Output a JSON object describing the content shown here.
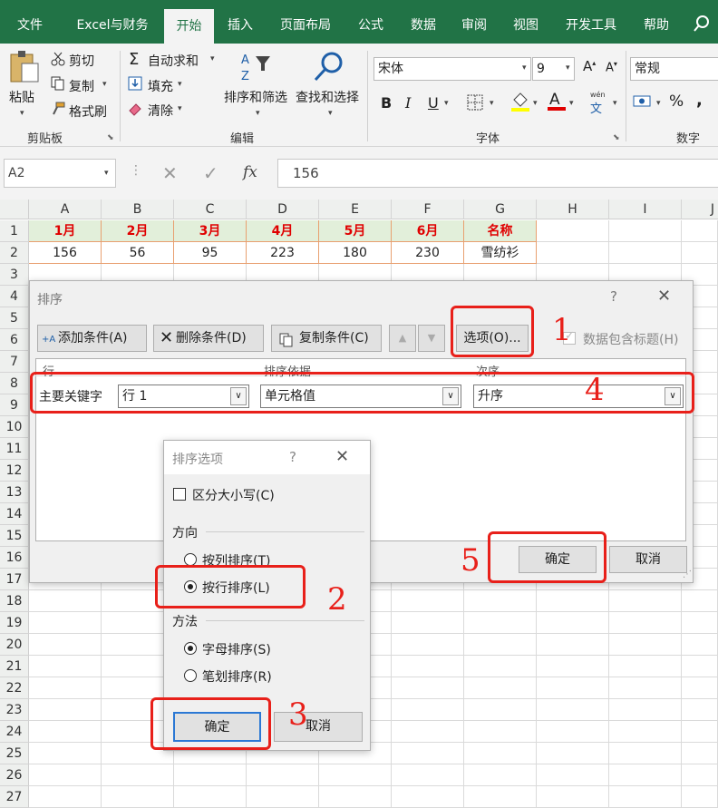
{
  "menu": {
    "tabs": [
      "文件",
      "Excel与财务",
      "开始",
      "插入",
      "页面布局",
      "公式",
      "数据",
      "审阅",
      "视图",
      "开发工具",
      "帮助"
    ],
    "active": "开始"
  },
  "ribbon": {
    "paste": "粘贴",
    "cut": "剪切",
    "copy": "复制",
    "format_painter": "格式刷",
    "clipboard_group": "剪贴板",
    "autosum": "自动求和",
    "fill": "填充",
    "clear": "清除",
    "sort_filter": "排序和筛选",
    "find_select": "查找和选择",
    "edit_group": "编辑",
    "font_name": "宋体",
    "font_size": "9",
    "font_group": "字体",
    "number_format": "常规",
    "number_group": "数字",
    "bold": "B",
    "italic": "I",
    "underline": "U",
    "wen": "wén",
    "wen_char": "文",
    "percent": "%",
    "comma": ","
  },
  "formula_bar": {
    "name_box": "A2",
    "fx": "fx",
    "value": "156"
  },
  "sheet": {
    "columns": [
      "A",
      "B",
      "C",
      "D",
      "E",
      "F",
      "G",
      "H",
      "I",
      "J"
    ],
    "rows": [
      "1",
      "2",
      "3",
      "4",
      "5",
      "6",
      "7",
      "8",
      "9",
      "10",
      "11",
      "12",
      "13",
      "14",
      "15",
      "16",
      "17",
      "18",
      "19",
      "20",
      "21",
      "22",
      "23",
      "24",
      "25",
      "26",
      "27"
    ],
    "row1": [
      "1月",
      "2月",
      "3月",
      "4月",
      "5月",
      "6月",
      "名称"
    ],
    "row2": [
      "156",
      "56",
      "95",
      "223",
      "180",
      "230",
      "雪纺衫"
    ]
  },
  "sort_dialog": {
    "title": "排序",
    "help": "?",
    "add": "添加条件(A)",
    "delete": "删除条件(D)",
    "copy": "复制条件(C)",
    "options": "选项(O)...",
    "header_checkbox": "数据包含标题(H)",
    "col_row": "行",
    "col_sorton": "排序依据",
    "col_order": "次序",
    "main_key": "主要关键字",
    "key_value": "行 1",
    "sorton_value": "单元格值",
    "order_value": "升序",
    "ok": "确定",
    "cancel": "取消"
  },
  "options_dialog": {
    "title": "排序选项",
    "help": "?",
    "case": "区分大小写(C)",
    "direction": "方向",
    "by_col": "按列排序(T)",
    "by_row": "按行排序(L)",
    "method": "方法",
    "alpha": "字母排序(S)",
    "stroke": "笔划排序(R)",
    "ok": "确定",
    "cancel": "取消"
  },
  "annotations": [
    "1",
    "2",
    "3",
    "4",
    "5"
  ],
  "colors": {
    "accent": "#217346",
    "highlight": "#e8201a"
  }
}
